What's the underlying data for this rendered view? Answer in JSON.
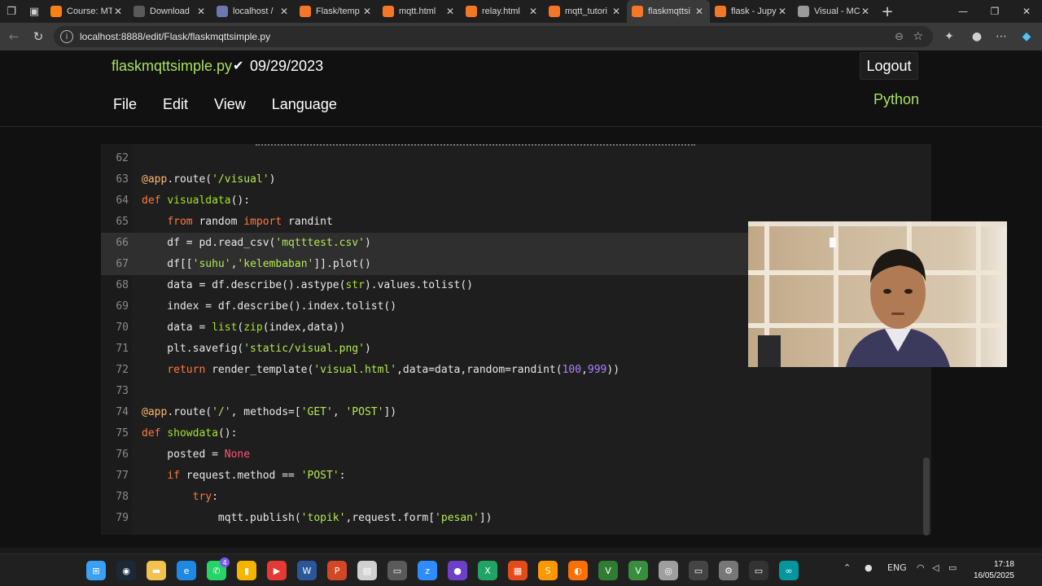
{
  "browser": {
    "tabs": [
      {
        "title": "Course: MT",
        "icon": "moodle-icon",
        "color": "#f98012",
        "active": false
      },
      {
        "title": "Download",
        "icon": "download-icon",
        "color": "#5a5a5a",
        "active": false
      },
      {
        "title": "localhost /",
        "icon": "phpmyadmin-icon",
        "color": "#6c78af",
        "active": false
      },
      {
        "title": "Flask/temp",
        "icon": "jupyter-icon",
        "color": "#f37726",
        "active": false
      },
      {
        "title": "mqtt.html",
        "icon": "file-icon",
        "color": "#f37726",
        "active": false
      },
      {
        "title": "relay.html",
        "icon": "file-icon",
        "color": "#f37726",
        "active": false
      },
      {
        "title": "mqtt_tutori",
        "icon": "notebook-icon",
        "color": "#f37726",
        "active": false
      },
      {
        "title": "flaskmqttsi",
        "icon": "file-icon",
        "color": "#f37726",
        "active": true
      },
      {
        "title": "flask - Jupy",
        "icon": "notebook-icon",
        "color": "#f37726",
        "active": false
      },
      {
        "title": "Visual - MC",
        "icon": "globe-icon",
        "color": "#9a9a9a",
        "active": false
      }
    ],
    "url": "localhost:8888/edit/Flask/flaskmqttsimple.py"
  },
  "editor_header": {
    "filename": "flaskmqttsimple.py",
    "checkpoint_date": "09/29/2023",
    "logout_label": "Logout",
    "menu": [
      "File",
      "Edit",
      "View",
      "Language"
    ],
    "language": "Python"
  },
  "code_lines": [
    {
      "num": "62",
      "tokens": []
    },
    {
      "num": "63",
      "tokens": [
        {
          "t": "@app",
          "c": "dec"
        },
        {
          "t": ".route(",
          "c": ""
        },
        {
          "t": "'/visual'",
          "c": "str"
        },
        {
          "t": ")",
          "c": ""
        }
      ]
    },
    {
      "num": "64",
      "tokens": [
        {
          "t": "def",
          "c": "kw"
        },
        {
          "t": " ",
          "c": ""
        },
        {
          "t": "visualdata",
          "c": "fn"
        },
        {
          "t": "():",
          "c": ""
        }
      ]
    },
    {
      "num": "65",
      "tokens": [
        {
          "t": "    ",
          "c": ""
        },
        {
          "t": "from",
          "c": "kw"
        },
        {
          "t": " random ",
          "c": ""
        },
        {
          "t": "import",
          "c": "kw"
        },
        {
          "t": " randint",
          "c": ""
        }
      ]
    },
    {
      "num": "66",
      "tokens": [
        {
          "t": "    df = pd.read_csv(",
          "c": ""
        },
        {
          "t": "'mqtttest.csv'",
          "c": "str"
        },
        {
          "t": ")",
          "c": ""
        }
      ]
    },
    {
      "num": "67",
      "tokens": [
        {
          "t": "    df[[",
          "c": ""
        },
        {
          "t": "'suhu'",
          "c": "str"
        },
        {
          "t": ",",
          "c": ""
        },
        {
          "t": "'kelembaban'",
          "c": "str"
        },
        {
          "t": "]].plot()",
          "c": ""
        }
      ]
    },
    {
      "num": "68",
      "tokens": [
        {
          "t": "    data = df.describe().astype(",
          "c": ""
        },
        {
          "t": "str",
          "c": "fn"
        },
        {
          "t": ").values.tolist()",
          "c": ""
        }
      ]
    },
    {
      "num": "69",
      "tokens": [
        {
          "t": "    index = df.describe().index.tolist()",
          "c": ""
        }
      ]
    },
    {
      "num": "70",
      "tokens": [
        {
          "t": "    data = ",
          "c": ""
        },
        {
          "t": "list",
          "c": "fn"
        },
        {
          "t": "(",
          "c": ""
        },
        {
          "t": "zip",
          "c": "fn"
        },
        {
          "t": "(index,data))",
          "c": ""
        }
      ]
    },
    {
      "num": "71",
      "tokens": [
        {
          "t": "    plt.savefig(",
          "c": ""
        },
        {
          "t": "'static/visual.png'",
          "c": "str"
        },
        {
          "t": ")",
          "c": ""
        }
      ]
    },
    {
      "num": "72",
      "tokens": [
        {
          "t": "    ",
          "c": ""
        },
        {
          "t": "return",
          "c": "kw"
        },
        {
          "t": " render_template(",
          "c": ""
        },
        {
          "t": "'visual.html'",
          "c": "str"
        },
        {
          "t": ",data=data,random=randint(",
          "c": ""
        },
        {
          "t": "100",
          "c": "num"
        },
        {
          "t": ",",
          "c": ""
        },
        {
          "t": "999",
          "c": "num"
        },
        {
          "t": "))",
          "c": ""
        }
      ]
    },
    {
      "num": "73",
      "tokens": []
    },
    {
      "num": "74",
      "tokens": [
        {
          "t": "@app",
          "c": "dec"
        },
        {
          "t": ".route(",
          "c": ""
        },
        {
          "t": "'/'",
          "c": "str"
        },
        {
          "t": ", methods=[",
          "c": ""
        },
        {
          "t": "'GET'",
          "c": "str"
        },
        {
          "t": ", ",
          "c": ""
        },
        {
          "t": "'POST'",
          "c": "str"
        },
        {
          "t": "])",
          "c": ""
        }
      ]
    },
    {
      "num": "75",
      "tokens": [
        {
          "t": "def",
          "c": "kw"
        },
        {
          "t": " ",
          "c": ""
        },
        {
          "t": "showdata",
          "c": "fn"
        },
        {
          "t": "():",
          "c": ""
        }
      ]
    },
    {
      "num": "76",
      "tokens": [
        {
          "t": "    posted = ",
          "c": ""
        },
        {
          "t": "None",
          "c": "none"
        }
      ]
    },
    {
      "num": "77",
      "tokens": [
        {
          "t": "    ",
          "c": ""
        },
        {
          "t": "if",
          "c": "kw"
        },
        {
          "t": " request.method == ",
          "c": ""
        },
        {
          "t": "'POST'",
          "c": "str"
        },
        {
          "t": ":",
          "c": ""
        }
      ]
    },
    {
      "num": "78",
      "tokens": [
        {
          "t": "        ",
          "c": ""
        },
        {
          "t": "try",
          "c": "kw"
        },
        {
          "t": ":",
          "c": ""
        }
      ]
    },
    {
      "num": "79",
      "tokens": [
        {
          "t": "            mqtt.publish(",
          "c": ""
        },
        {
          "t": "'topik'",
          "c": "str"
        },
        {
          "t": ",request.form[",
          "c": ""
        },
        {
          "t": "'pesan'",
          "c": "str"
        },
        {
          "t": "])",
          "c": ""
        }
      ]
    }
  ],
  "selected_lines": [
    "66",
    "67"
  ],
  "taskbar": {
    "apps": [
      {
        "name": "start-icon",
        "glyph": "⊞",
        "color": "#3aa0f3"
      },
      {
        "name": "steam-icon",
        "glyph": "◉",
        "color": "#1b2838"
      },
      {
        "name": "explorer-icon",
        "glyph": "▬",
        "color": "#f2c14e"
      },
      {
        "name": "edge-icon",
        "glyph": "e",
        "color": "#1e88e5"
      },
      {
        "name": "whatsapp-icon",
        "glyph": "✆",
        "color": "#25d366"
      },
      {
        "name": "files-icon",
        "glyph": "▮",
        "color": "#f4b400"
      },
      {
        "name": "media-icon",
        "glyph": "▶",
        "color": "#e53935"
      },
      {
        "name": "word-icon",
        "glyph": "W",
        "color": "#2b579a"
      },
      {
        "name": "powerpoint-icon",
        "glyph": "P",
        "color": "#d24726"
      },
      {
        "name": "document-icon",
        "glyph": "▤",
        "color": "#d0d0d0"
      },
      {
        "name": "terminal-icon",
        "glyph": "▭",
        "color": "#5a5a5a"
      },
      {
        "name": "zoom-icon",
        "glyph": "z",
        "color": "#2d8cff"
      },
      {
        "name": "github-icon",
        "glyph": "●",
        "color": "#6e40c9"
      },
      {
        "name": "excel-icon",
        "glyph": "X",
        "color": "#21a366"
      },
      {
        "name": "calculator-icon",
        "glyph": "▦",
        "color": "#e64a19"
      },
      {
        "name": "sublime-icon",
        "glyph": "S",
        "color": "#ff9800"
      },
      {
        "name": "blender-icon",
        "glyph": "◐",
        "color": "#ff6f00"
      },
      {
        "name": "vim-icon",
        "glyph": "V",
        "color": "#2e7d32"
      },
      {
        "name": "vim2-icon",
        "glyph": "V",
        "color": "#388e3c"
      },
      {
        "name": "chrome-icon",
        "glyph": "◎",
        "color": "#9e9e9e"
      },
      {
        "name": "cmd-icon",
        "glyph": "▭",
        "color": "#444444"
      },
      {
        "name": "settings-icon",
        "glyph": "⚙",
        "color": "#777777"
      },
      {
        "name": "console-icon",
        "glyph": "▭",
        "color": "#333333"
      },
      {
        "name": "arduino-icon",
        "glyph": "∞",
        "color": "#00979d"
      }
    ],
    "tray_lang": "ENG",
    "time": "17:18",
    "date": "16/05/2025",
    "whatsapp_badge": "4"
  }
}
